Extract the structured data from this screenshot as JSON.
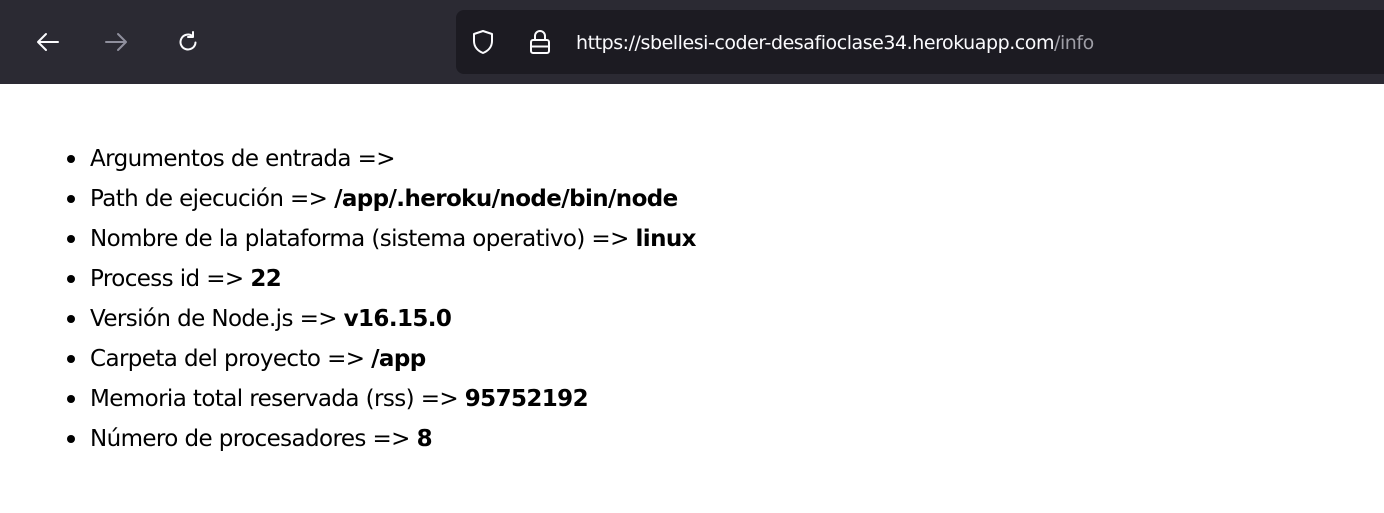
{
  "browser": {
    "url_domain": "https://sbellesi-coder-desafioclase34.herokuapp.com",
    "url_path": "/info",
    "icons": {
      "back": "arrow-left-icon",
      "forward": "arrow-right-icon",
      "reload": "reload-icon",
      "tracking": "shield-icon",
      "security": "lock-icon"
    },
    "colors": {
      "toolbar": "#2b2a33",
      "urlbar": "#1c1b22",
      "icon": "#fbfbfe",
      "icon_disabled": "#8f8f9d"
    }
  },
  "info": {
    "items": [
      {
        "label": "Argumentos de entrada => ",
        "value": ""
      },
      {
        "label": "Path de ejecución => ",
        "value": "/app/.heroku/node/bin/node"
      },
      {
        "label": "Nombre de la plataforma (sistema operativo) => ",
        "value": "linux"
      },
      {
        "label": "Process id => ",
        "value": "22"
      },
      {
        "label": "Versión de Node.js => ",
        "value": "v16.15.0"
      },
      {
        "label": "Carpeta del proyecto => ",
        "value": "/app"
      },
      {
        "label": "Memoria total reservada (rss) => ",
        "value": "95752192"
      },
      {
        "label": "Número de procesadores => ",
        "value": "8"
      }
    ]
  }
}
